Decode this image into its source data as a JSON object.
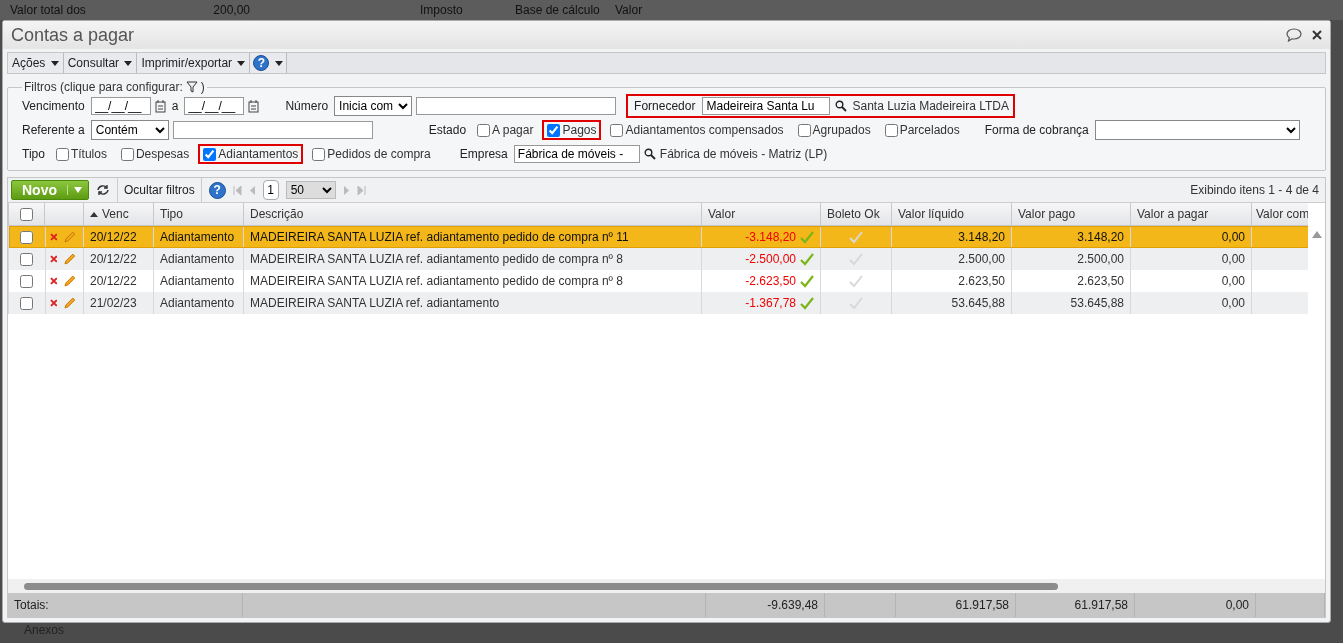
{
  "background": {
    "top_texts": [
      "Valor total dos",
      "200,00",
      "Imposto",
      "Base de cálculo",
      "Valor"
    ],
    "bottom_text": "Anexos"
  },
  "window": {
    "title": "Contas a pagar"
  },
  "menu": [
    {
      "label": "Ações"
    },
    {
      "label": "Consultar"
    },
    {
      "label": "Imprimir/exportar"
    }
  ],
  "filters": {
    "legend_start": "Filtros (clique para configurar:",
    "legend_end": ")",
    "vencimento": {
      "label": "Vencimento",
      "from": "__/__/__",
      "separator": "a",
      "to": "__/__/__"
    },
    "numero": {
      "label": "Número",
      "operator": "Inicia com"
    },
    "fornecedor": {
      "label": "Fornecedor",
      "value": "Madeireira Santa Lu",
      "result": "Santa Luzia Madeireira LTDA",
      "highlighted": true
    },
    "referente": {
      "label": "Referente a",
      "operator": "Contém"
    },
    "estado": {
      "label": "Estado",
      "options": [
        {
          "label": "A pagar",
          "checked": false,
          "highlighted": false
        },
        {
          "label": "Pagos",
          "checked": true,
          "highlighted": true
        },
        {
          "label": "Adiantamentos compensados",
          "checked": false,
          "highlighted": false
        },
        {
          "label": "Agrupados",
          "checked": false,
          "highlighted": false
        },
        {
          "label": "Parcelados",
          "checked": false,
          "highlighted": false
        }
      ]
    },
    "forma_cobranca": {
      "label": "Forma de cobrança"
    },
    "tipo": {
      "label": "Tipo",
      "options": [
        {
          "label": "Títulos",
          "checked": false,
          "highlighted": false
        },
        {
          "label": "Despesas",
          "checked": false,
          "highlighted": false
        },
        {
          "label": "Adiantamentos",
          "checked": true,
          "highlighted": true
        },
        {
          "label": "Pedidos de compra",
          "checked": false,
          "highlighted": false
        }
      ]
    },
    "empresa": {
      "label": "Empresa",
      "value": "Fábrica de móveis -",
      "result": "Fábrica de móveis - Matriz (LP)"
    }
  },
  "help_glyph": "?",
  "toolbar": {
    "new_button": "Novo",
    "help_glyph": "?",
    "hide_filters": "Ocultar filtros",
    "page": "1",
    "page_size": "50",
    "info": "Exibindo itens 1 - 4 de 4"
  },
  "table": {
    "all_checked": false,
    "columns": [
      "Venc",
      "Tipo",
      "Descrição",
      "Valor",
      "Boleto Ok",
      "Valor líquido",
      "Valor pago",
      "Valor a pagar",
      "Valor com"
    ],
    "rows": [
      {
        "selected": true,
        "checked": false,
        "venc": "20/12/22",
        "tipo": "Adiantamento",
        "descricao": "MADEIREIRA SANTA LUZIA ref. adiantamento pedido de compra nº 11",
        "valor": "-3.148,20",
        "valor_liquido": "3.148,20",
        "valor_pago": "3.148,20",
        "valor_a_pagar": "0,00"
      },
      {
        "selected": false,
        "checked": false,
        "venc": "20/12/22",
        "tipo": "Adiantamento",
        "descricao": "MADEIREIRA SANTA LUZIA ref. adiantamento pedido de compra nº 8",
        "valor": "-2.500,00",
        "valor_liquido": "2.500,00",
        "valor_pago": "2.500,00",
        "valor_a_pagar": "0,00"
      },
      {
        "selected": false,
        "checked": false,
        "venc": "20/12/22",
        "tipo": "Adiantamento",
        "descricao": "MADEIREIRA SANTA LUZIA ref. adiantamento pedido de compra nº 8",
        "valor": "-2.623,50",
        "valor_liquido": "2.623,50",
        "valor_pago": "2.623,50",
        "valor_a_pagar": "0,00"
      },
      {
        "selected": false,
        "checked": false,
        "venc": "21/02/23",
        "tipo": "Adiantamento",
        "descricao": "MADEIREIRA SANTA LUZIA ref. adiantamento",
        "valor": "-1.367,78",
        "valor_liquido": "53.645,88",
        "valor_pago": "53.645,88",
        "valor_a_pagar": "0,00"
      }
    ],
    "totals": {
      "label": "Totais:",
      "valor": "-9.639,48",
      "valor_liquido": "61.917,58",
      "valor_pago": "61.917,58",
      "valor_a_pagar": "0,00"
    }
  }
}
